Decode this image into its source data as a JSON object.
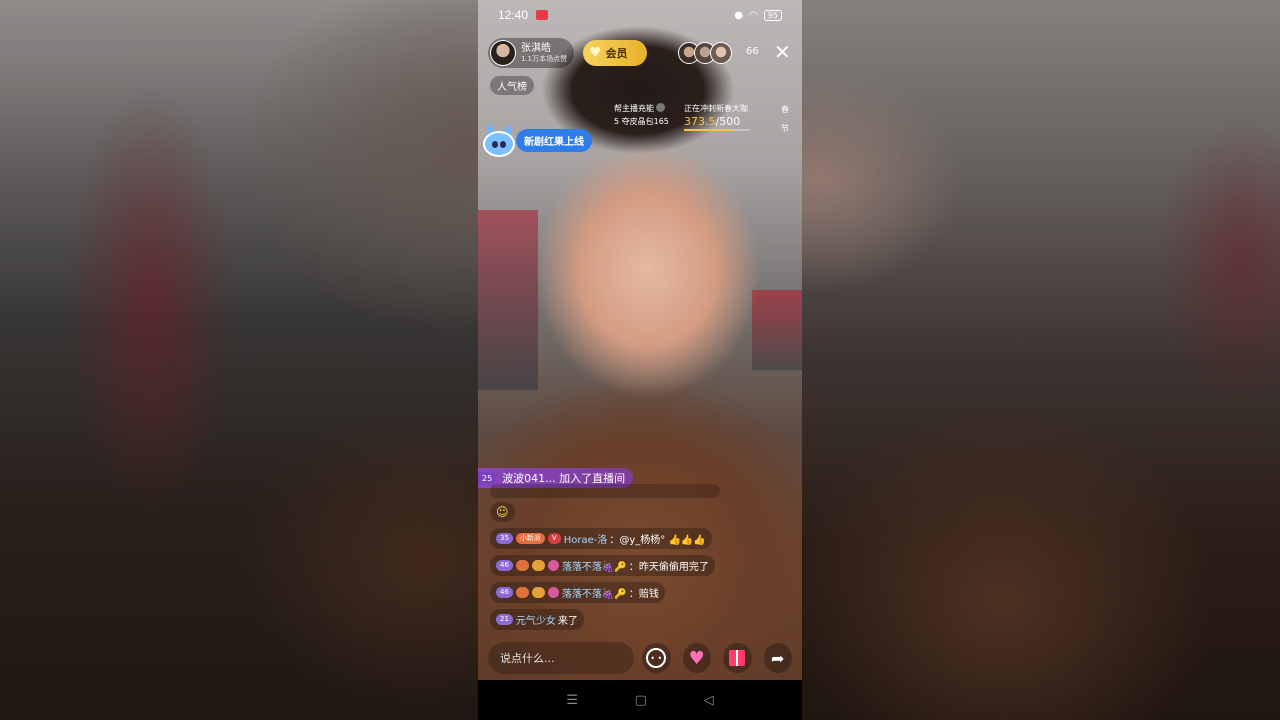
{
  "status_bar": {
    "time": "12:40",
    "battery": "95"
  },
  "streamer": {
    "name": "张淇皓",
    "subtitle": "1.1万本场点赞"
  },
  "vip": {
    "label": "会员"
  },
  "viewers": {
    "count": "66"
  },
  "rank": {
    "label": "人气榜"
  },
  "energy": {
    "title": "帮主播充能",
    "sub": "5 夺皮晶包165"
  },
  "event": {
    "title": "正在冲刺新春大咖",
    "current": "373.5",
    "total": "/500",
    "progress": 0.747
  },
  "festival": {
    "chars": [
      "春",
      "节"
    ]
  },
  "banner": {
    "label": "新剧红果上线"
  },
  "join_notice": {
    "level": "25",
    "text": "波波041... 加入了直播间"
  },
  "chat": [
    {
      "level": "35",
      "fan_label": "小新派",
      "user": "Horae-洛",
      "text": "：@y_杨杨° 👍👍👍"
    },
    {
      "level": "46",
      "user": "落落不落🍇🔑",
      "text": "：昨天偷偷用完了"
    },
    {
      "level": "46",
      "user": "落落不落🍇🔑",
      "text": "：赔钱"
    },
    {
      "level": "21",
      "user": "元气少女",
      "text": " 来了"
    }
  ],
  "input": {
    "placeholder": "说点什么..."
  },
  "icons": {
    "close": "close-icon",
    "emoji": "emoji-icon",
    "heart_gift": "heart-gift-icon",
    "gift": "gift-icon",
    "share": "share-icon"
  },
  "colors": {
    "accent_gold": "#f5c542",
    "banner_blue": "#2e7de8",
    "join_purple": "#8c46c8"
  }
}
